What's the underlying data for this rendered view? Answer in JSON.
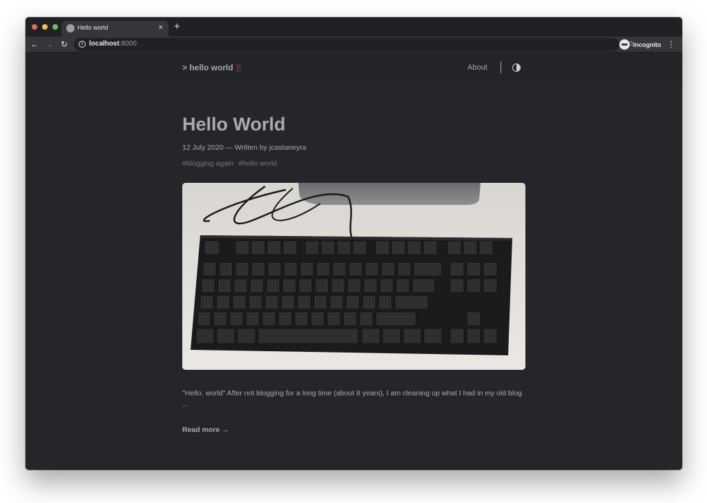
{
  "browser": {
    "tab_title": "Hello world",
    "url_host": "localhost",
    "url_port": ":8000",
    "profile_label": "Incognito",
    "new_tab_symbol": "+",
    "close_symbol": "×"
  },
  "site": {
    "logo_text": "> hello world",
    "nav": {
      "about_label": "About"
    }
  },
  "post": {
    "title": "Hello World",
    "meta": "12 July 2020 — Written by jcastaneyra",
    "tags": [
      "#blogging again",
      "#hello world"
    ],
    "cover_image": "keyboard-photo",
    "excerpt": "\"Hello, world\" After not blogging for a long time (about 8 years), I am cleaning up what I had in my old blog ...",
    "read_more": "Read more →"
  },
  "colors": {
    "background": "#252629",
    "header": "#232427",
    "text": "#a9abb3",
    "muted": "#74767d",
    "cursor": "#4a2a32"
  }
}
